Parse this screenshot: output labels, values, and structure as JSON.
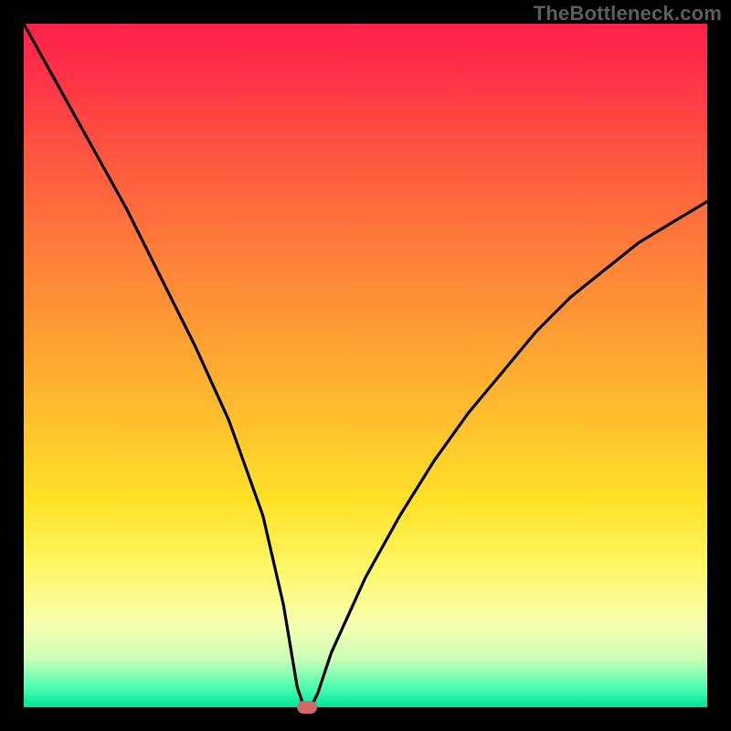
{
  "watermark": "TheBottleneck.com",
  "colors": {
    "frame": "#000000",
    "curve": "#000000",
    "marker": "#cf6b6b",
    "gradient_top": "#ff1f4b",
    "gradient_bottom": "#00e39a"
  },
  "chart_data": {
    "type": "line",
    "title": "",
    "xlabel": "",
    "ylabel": "",
    "xlim": [
      0,
      100
    ],
    "ylim": [
      0,
      100
    ],
    "grid": false,
    "legend": false,
    "series": [
      {
        "name": "bottleneck-curve",
        "x": [
          0,
          5,
          10,
          15,
          20,
          25,
          30,
          35,
          38,
          40,
          41,
          42,
          43,
          45,
          50,
          55,
          60,
          65,
          70,
          75,
          80,
          85,
          90,
          95,
          100
        ],
        "y": [
          100,
          91,
          82,
          73,
          63,
          53,
          42,
          28,
          15,
          3,
          0,
          0,
          2,
          8,
          19,
          28,
          36,
          43,
          49,
          55,
          60,
          64,
          68,
          71,
          74
        ]
      }
    ],
    "marker": {
      "x": 41.5,
      "y": 0
    },
    "notes": "V-shaped bottleneck curve plotted over a vertical red→yellow→green heat gradient. Minimum (optimal point) at roughly x≈41–42 where the curve touches the green band; legs rise steeply on both sides. No axis ticks, labels, or legend are rendered."
  }
}
